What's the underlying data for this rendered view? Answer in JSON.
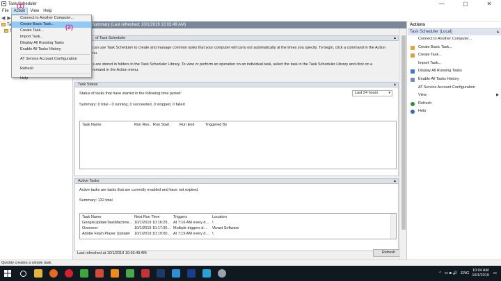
{
  "window": {
    "title": "Task Scheduler",
    "controls": [
      "—",
      "▢",
      "✕"
    ]
  },
  "menubar": {
    "file": "File",
    "action": "Action",
    "view": "View",
    "help": "Help"
  },
  "toolbar": {
    "back": "◀",
    "forward": "▶",
    "extra": "◫"
  },
  "tree": {
    "items": [
      {
        "label": "Task"
      },
      {
        "label": "T"
      }
    ]
  },
  "center": {
    "header": "Summary (Last refreshed: 10/1/2019 10:03:49 AM)",
    "overview": {
      "title": "of Task Scheduler",
      "text1": "can use Task Scheduler to create and manage common tasks that your computer will carry out automatically at the times you specify. To begin, click a command in the Action",
      "text2": "nu.",
      "text3": "s are stored in folders in the Task Scheduler Library. To view or perform an operation on an individual task, select the task in the Task Scheduler Library and click on a",
      "text4": "mmand in the Action menu."
    },
    "status": {
      "title": "Task Status",
      "prompt": "Status of tasks that have started in the following time period:",
      "period": "Last 24 hours",
      "summary": "Summary: 0 total - 0 running, 0 succeeded, 0 stopped, 0 failed",
      "columns": [
        "Task Name",
        "Run Res...",
        "Run Start",
        "Run End",
        "Triggered By"
      ]
    },
    "active": {
      "title": "Active Tasks",
      "desc": "Active tasks are tasks that are currently enabled and have not expired.",
      "summary": "Summary: 132 total",
      "columns": [
        "Task Name",
        "Next Run Time",
        "Triggers",
        "Location"
      ],
      "rows": [
        [
          "GoogleUpdateTaskMachine...",
          "10/1/2019 10:16:29...",
          "At 7:16 AM every d...",
          "\\"
        ],
        [
          "Overseer",
          "10/1/2019 10:17:36...",
          "Multiple triggers d...",
          "\\Avast Software"
        ],
        [
          "Adobe Flash Player Updater",
          "10/1/2019 10:19:00...",
          "At 7:19 AM every d...",
          "\\"
        ]
      ]
    },
    "footer": {
      "last_refreshed": "Last refreshed at 10/1/2019 10:03:49 AM",
      "refresh": "Refresh"
    }
  },
  "actions": {
    "title": "Actions",
    "group": "Task Scheduler (Local)",
    "items": [
      {
        "label": "Connect to Another Computer...",
        "icon": "",
        "color": ""
      },
      {
        "label": "Create Basic Task...",
        "icon": "wand-icon",
        "color": "#e4a23a"
      },
      {
        "label": "Create Task...",
        "icon": "new-task-icon",
        "color": "#d9a441"
      },
      {
        "label": "Import Task...",
        "icon": "",
        "color": ""
      },
      {
        "label": "Display All Running Tasks",
        "icon": "list-icon",
        "color": "#3b7bd1"
      },
      {
        "label": "Enable All Tasks History",
        "icon": "history-icon",
        "color": "#6e8fb7"
      },
      {
        "label": "AT Service Account Configuration",
        "icon": "",
        "color": ""
      },
      {
        "label": "View",
        "icon": "",
        "color": "",
        "submenu": "▶"
      },
      {
        "label": "Refresh",
        "icon": "refresh-icon",
        "color": "#2e8b3c"
      },
      {
        "label": "Help",
        "icon": "help-icon",
        "color": "#2f67c5"
      }
    ]
  },
  "statusbar": {
    "text": "Quickly creates a simple task."
  },
  "action_menu": {
    "items": [
      {
        "label": "Connect to Another Computer..."
      },
      {
        "label": "Create Basic Task...",
        "highlighted": true
      },
      {
        "label": "Create Task..."
      },
      {
        "label": "Import Task..."
      },
      {
        "label": "Display All Running Tasks"
      },
      {
        "label": "Enable All Tasks History"
      },
      {
        "label": "AT Service Account Configuration"
      },
      {
        "label": "Refresh"
      },
      {
        "label": "Help"
      }
    ]
  },
  "annotations": {
    "step1": "(1)",
    "step2": "(2)"
  },
  "taskbar": {
    "apps": [
      {
        "name": "search-icon",
        "color": "#ffffff"
      },
      {
        "name": "file-explorer-icon",
        "color": "#e8b33c"
      },
      {
        "name": "firefox-icon",
        "color": "#e66a1f"
      },
      {
        "name": "opera-icon",
        "color": "#d32030"
      },
      {
        "name": "libreoffice-icon",
        "color": "#3aa83a"
      },
      {
        "name": "music-icon",
        "color": "#d04a3a"
      },
      {
        "name": "vlc-icon",
        "color": "#f08a1c"
      },
      {
        "name": "camtasia-icon",
        "color": "#4aa84a"
      },
      {
        "name": "recorder-icon",
        "color": "#c8303a"
      },
      {
        "name": "photoshop-icon",
        "color": "#1e3a6a"
      },
      {
        "name": "skype-icon",
        "color": "#2a8fd6"
      },
      {
        "name": "terminal-icon",
        "color": "#1c3c8c"
      },
      {
        "name": "video-icon",
        "color": "#28a0d8"
      },
      {
        "name": "task-scheduler-icon",
        "color": "#9aa4b0"
      }
    ],
    "tray": {
      "lang": "ENG",
      "time": "10:04 AM",
      "date": "10/1/2019",
      "arrows": "^",
      "icons": "▭ ⧈ 🔊"
    }
  }
}
